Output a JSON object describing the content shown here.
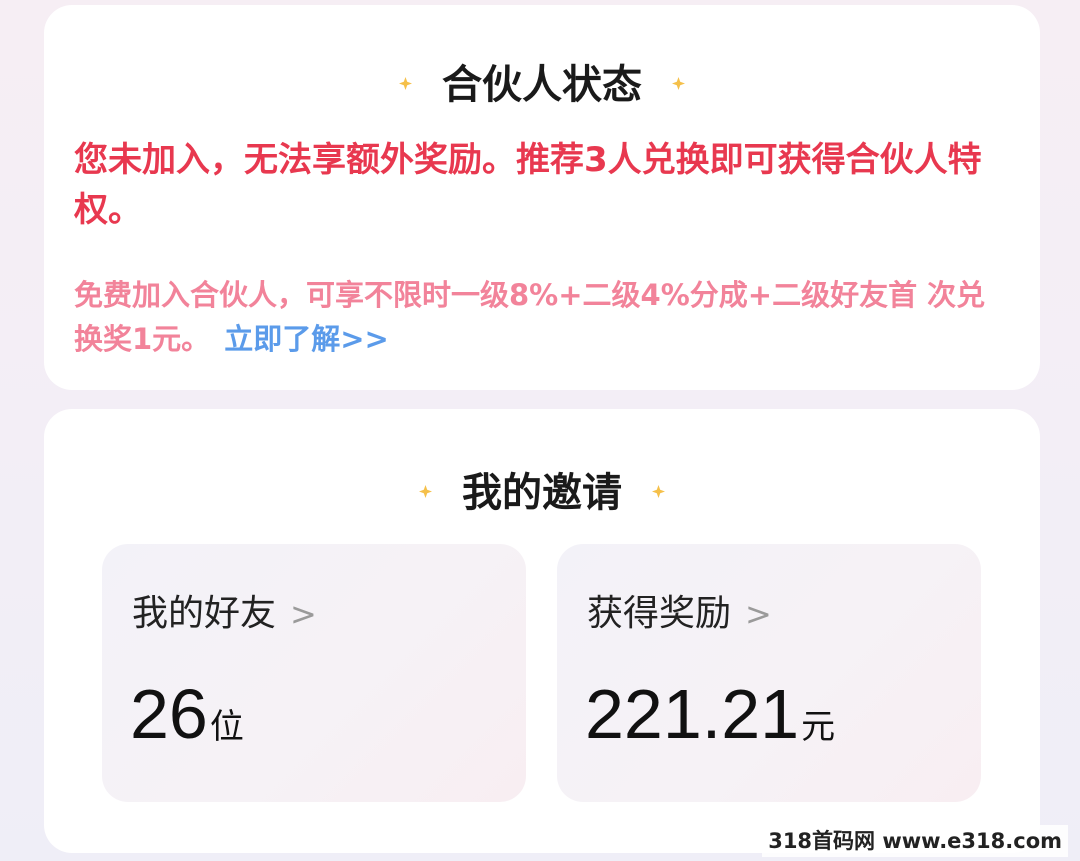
{
  "partner_status": {
    "title": "合伙人状态",
    "main_message": "您未加入，无法享额外奖励。推荐3人兑换即可获得合伙人特权。",
    "sub_message": "免费加入合伙人，可享不限时一级8%+二级4%分成+二级好友首 次兑换奖1元。",
    "learn_more_label": "立即了解>>"
  },
  "my_invites": {
    "title": "我的邀请",
    "friends": {
      "label": "我的好友",
      "chevron": ">",
      "value": "26",
      "unit": "位"
    },
    "rewards": {
      "label": "获得奖励",
      "chevron": ">",
      "value": "221.21",
      "unit": "元"
    }
  },
  "watermark": "318首码网 www.e318.com",
  "colors": {
    "accent_red": "#e8384f",
    "sub_pink": "#f2839a",
    "link_blue": "#5b9bea",
    "sparkle_gold": "#f5c04a"
  },
  "icons": {
    "sparkle": "sparkle-icon",
    "chevron": "chevron-right-icon"
  }
}
